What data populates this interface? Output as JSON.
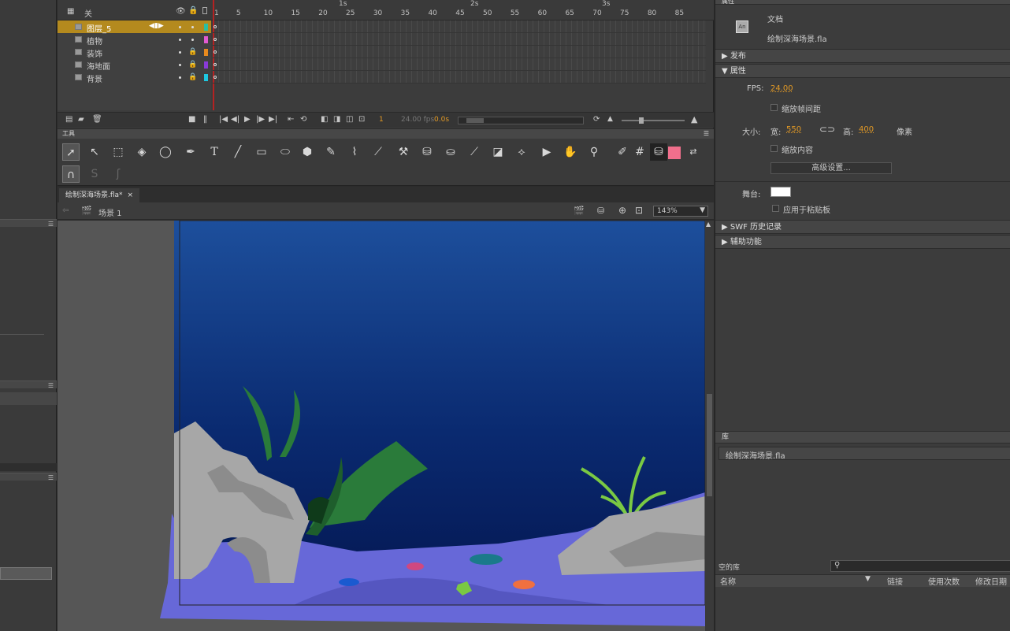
{
  "timeline": {
    "header_label": "关",
    "layers": [
      {
        "name": "图层_5",
        "selected": true,
        "color": "#2bbfa0",
        "locked": false
      },
      {
        "name": "植物",
        "selected": false,
        "color": "#e05ad0",
        "locked": false
      },
      {
        "name": "装饰",
        "selected": false,
        "color": "#e88a1e",
        "locked": true
      },
      {
        "name": "海地面",
        "selected": false,
        "color": "#8a3ad8",
        "locked": true
      },
      {
        "name": "背景",
        "selected": false,
        "color": "#1ec8e0",
        "locked": true
      }
    ],
    "frame_ticks": [
      "1",
      "5",
      "10",
      "15",
      "20",
      "25",
      "30",
      "35",
      "40",
      "45",
      "50",
      "55",
      "60",
      "65",
      "70",
      "75",
      "80",
      "85"
    ],
    "seconds": [
      "1s",
      "2s",
      "3s"
    ],
    "current_frame": "1",
    "fps_display": "24.00 fps",
    "time_display": "0.0s"
  },
  "tools": {
    "panel_title": "工具",
    "stroke_color": "#1a1a1a",
    "fill_color": "#f06f8c"
  },
  "document": {
    "tab_label": "绘制深海场景.fla*",
    "scene_label": "场景 1",
    "zoom": "143%"
  },
  "properties": {
    "panel_title": "属性",
    "doc_type": "文档",
    "doc_name": "绘制深海场景.fla",
    "publish_label": "发布",
    "props_label": "属性",
    "fps_label": "FPS:",
    "fps_value": "24.00",
    "scale_span_label": "缩放帧间距",
    "size_label": "大小:",
    "width_label": "宽:",
    "width_value": "550",
    "height_label": "高:",
    "height_value": "400",
    "unit_label": "像素",
    "scale_content_label": "缩放内容",
    "advanced_button": "高级设置...",
    "stage_label": "舞台:",
    "stage_color": "#ffffff",
    "apply_paste_label": "应用于粘贴板",
    "swf_history_label": "SWF 历史记录",
    "accessibility_label": "辅助功能"
  },
  "library": {
    "panel_title": "库",
    "doc_select": "绘制深海场景.fla",
    "empty_label": "空的库",
    "columns": [
      "名称",
      "链接",
      "使用次数",
      "修改日期"
    ]
  }
}
